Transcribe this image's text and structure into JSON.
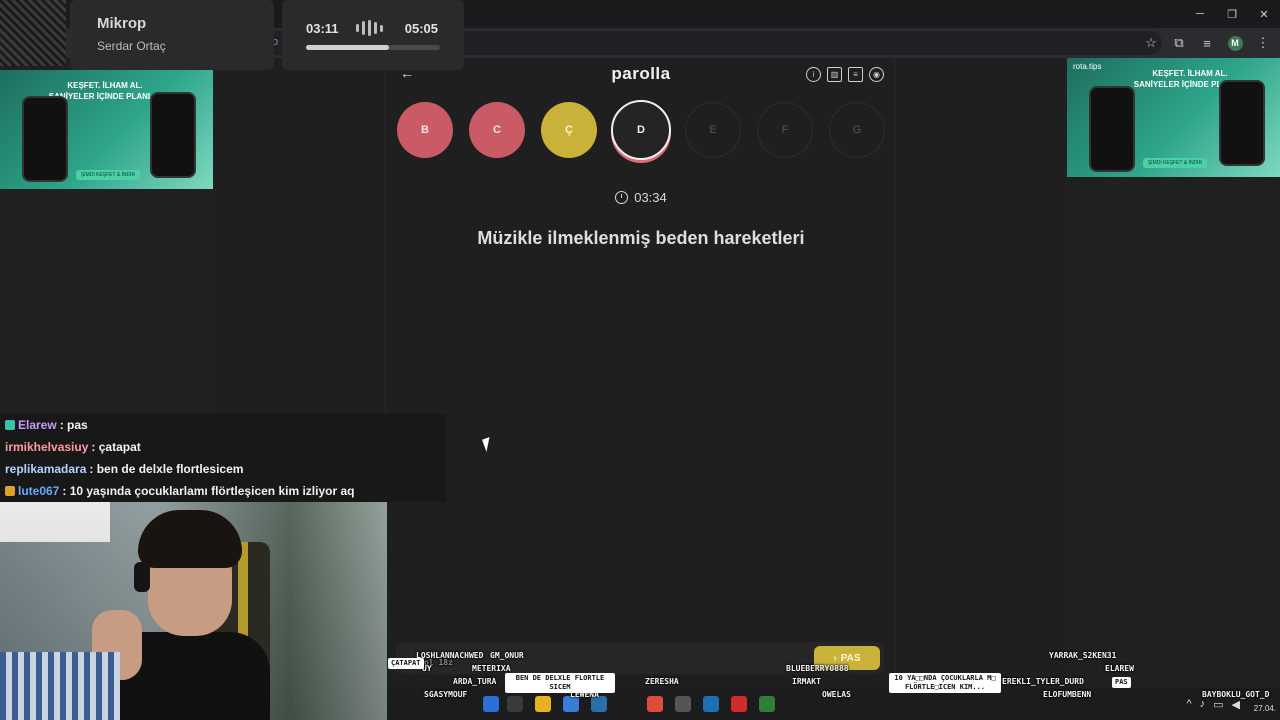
{
  "music": {
    "title": "Mikrop",
    "artist": "Serdar Ortaç",
    "elapsed": "03:11",
    "total": "05:05",
    "progress": 0.62
  },
  "browser": {
    "omnibox_text": "b",
    "profile_initial": "M"
  },
  "ads": {
    "left_text": "KEŞFET. İLHAM AL.\nSANİYELER İÇİNDE PLANLA!",
    "right_brand": "rota.tips",
    "right_text": "KEŞFET. İLHAM AL.\nSANİYELER İÇİNDE PLANLA!",
    "cta": "ŞİMDİ KEŞFET & İNDİR"
  },
  "game": {
    "title": "parolla",
    "letters": [
      {
        "label": "B",
        "state": "wrong"
      },
      {
        "label": "C",
        "state": "wrong"
      },
      {
        "label": "Ç",
        "state": "passed"
      },
      {
        "label": "D",
        "state": "current"
      },
      {
        "label": "E",
        "state": "pending"
      },
      {
        "label": "F",
        "state": "pending"
      },
      {
        "label": "G",
        "state": "pending"
      }
    ],
    "timer": "03:34",
    "question": "Müzikle ilmeklenmiş beden hareketleri",
    "pass_label": "PAS",
    "colors": {
      "wrong": "#c95a66",
      "passed": "#c9b13a",
      "current_ring": "#e06a75"
    }
  },
  "chat": {
    "messages": [
      {
        "user": "Elarew",
        "text": ": pas",
        "color": "#c79bff",
        "badge": "#36c3a6"
      },
      {
        "user": "irmikhelvasiuy",
        "text": ": çatapat",
        "color": "#ff9aa2",
        "badge": ""
      },
      {
        "user": "replikamadara",
        "text": ": ben de delxle flortlesicem",
        "color": "#b5d3ff",
        "badge": ""
      },
      {
        "user": "lute067",
        "text": ": 10 yaşında çocuklarlamı flörtleşicen kim izliyor aq",
        "color": "#6aa8ff",
        "badge": "#e0a12a"
      }
    ]
  },
  "emotes": {
    "names": [
      "LOSHLANNACHWED",
      "GM_ONUR",
      "METERIXA",
      "ARDA_TURA",
      "SGASYMOUF",
      "ZERESHA",
      "BLUEBERRY0888",
      "IRMAKT",
      "OWELAS",
      "YARRAK_S2KEN31",
      "ELAREW",
      "EREKLI_TYLER_DURD",
      "ELOFUMBENN",
      "BAYBOKLU_GOT_D",
      "LEWENA"
    ],
    "bubbles": [
      "ÇATAPAT",
      "BEN DE DELXLE FLORTLE SICEM",
      "10 YA□□NDA ÇOCUKLARLA M□ FLÖRTLE□ICEN KIM...",
      "PAS"
    ],
    "fragments": [
      "UY",
      "ol 18z"
    ]
  },
  "taskbar": {
    "date": "27.04."
  }
}
